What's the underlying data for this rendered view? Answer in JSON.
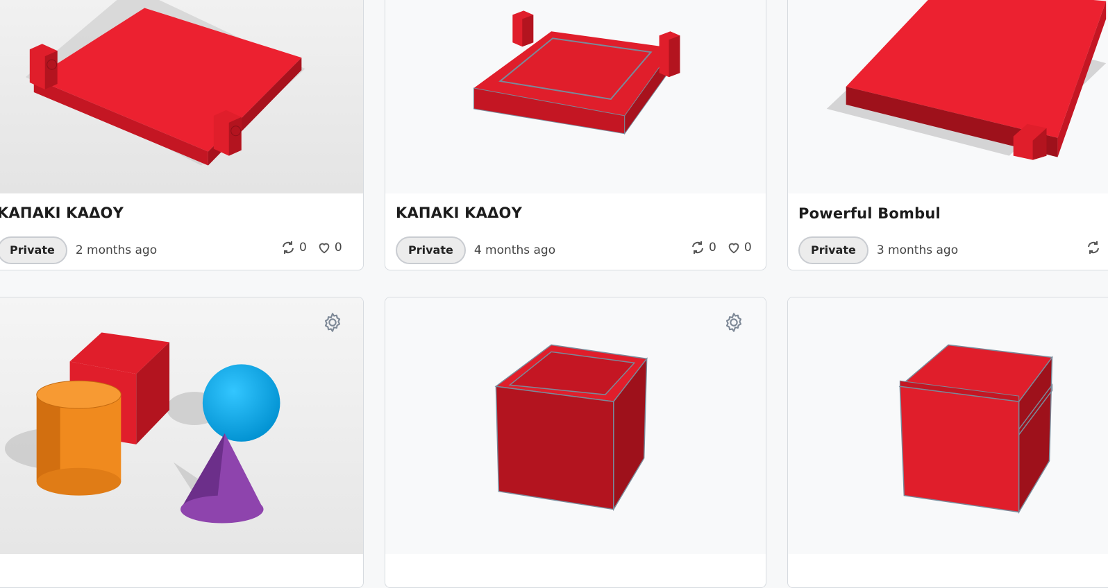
{
  "cards": [
    {
      "title": "ΚΑΠΑΚΙ ΚΑΔΟΥ",
      "visibility": "Private",
      "updated": "2 months ago",
      "remixes": "0",
      "likes": "0"
    },
    {
      "title": "ΚΑΠΑΚΙ ΚΑΔΟΥ",
      "visibility": "Private",
      "updated": "4 months ago",
      "remixes": "0",
      "likes": "0"
    },
    {
      "title": "Powerful Bombul",
      "visibility": "Private",
      "updated": "3 months ago"
    }
  ],
  "icons": {
    "remix": "remix-icon",
    "like": "heart-icon",
    "settings": "gear-icon"
  },
  "colors": {
    "model_red": "#e01e2b",
    "orange": "#f5871f",
    "blue": "#00b3f0",
    "purple": "#8e44ad",
    "border": "#d7dbe0"
  }
}
